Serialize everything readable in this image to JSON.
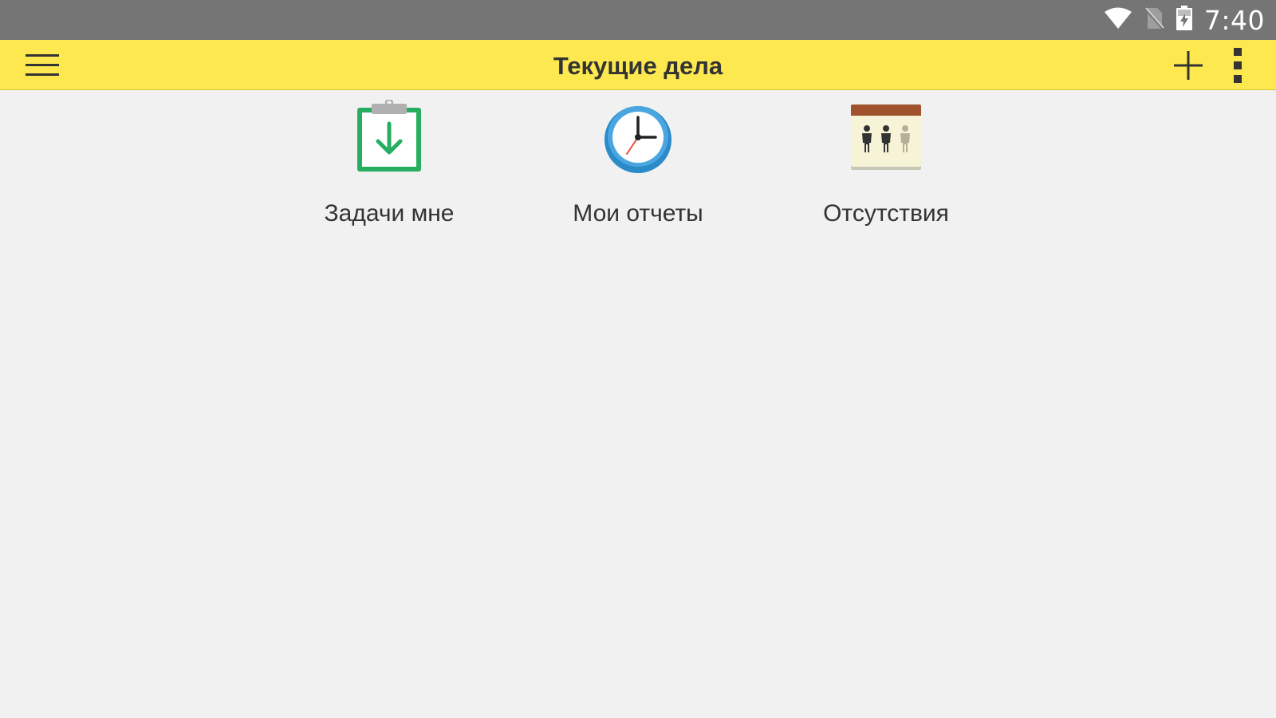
{
  "status_bar": {
    "time": "7:40",
    "icons": [
      "wifi-icon",
      "no-sim-icon",
      "battery-charging-icon"
    ]
  },
  "app_bar": {
    "title": "Текущие дела",
    "menu_icon": "hamburger-menu-icon",
    "add_icon": "plus-icon",
    "more_icon": "more-vertical-icon"
  },
  "tiles": [
    {
      "label": "Задачи мне",
      "icon": "clipboard-download-icon"
    },
    {
      "label": "Мои отчеты",
      "icon": "clock-icon"
    },
    {
      "label": "Отсутствия",
      "icon": "absence-calendar-icon"
    }
  ],
  "colors": {
    "status_bar": "#757575",
    "app_bar": "#fde94f",
    "background": "#f1f1f1",
    "text": "#333333",
    "clipboard_green": "#27ae60",
    "clock_blue": "#3c9ad6",
    "calendar_brown": "#a0522d"
  }
}
